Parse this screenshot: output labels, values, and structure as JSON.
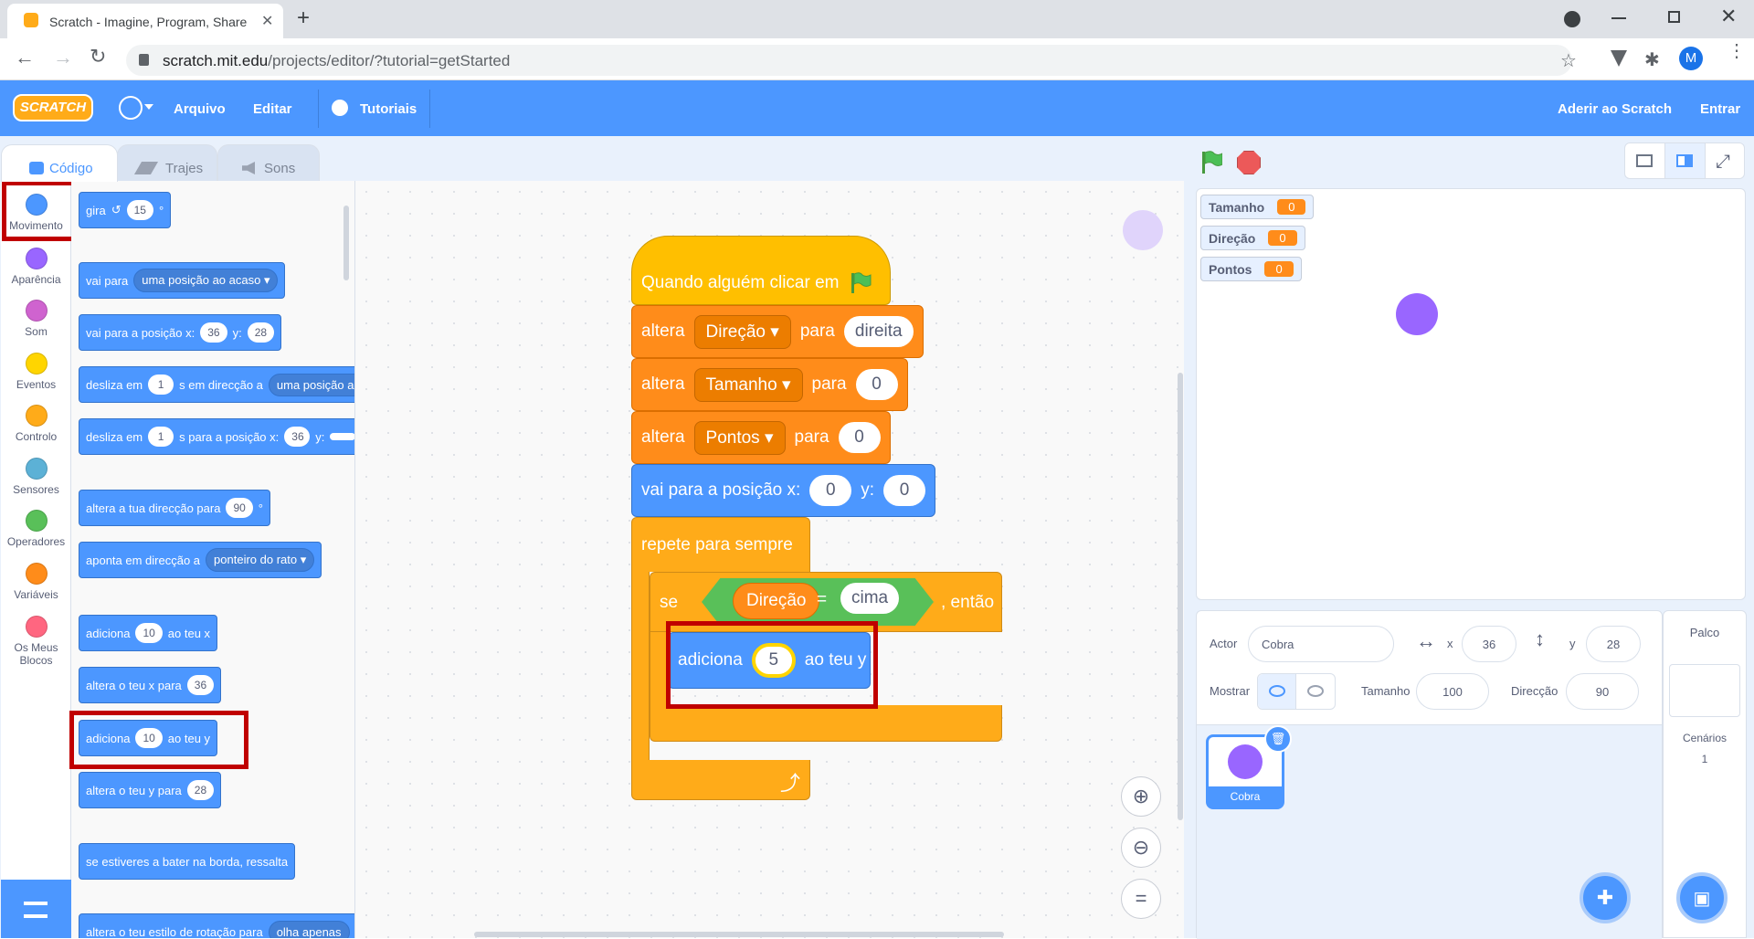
{
  "browser": {
    "tab_title": "Scratch - Imagine, Program, Share",
    "url_host": "scratch.mit.edu",
    "url_path": "/projects/editor/?tutorial=getStarted",
    "profile_initial": "M"
  },
  "menubar": {
    "logo": "SCRATCH",
    "file": "Arquivo",
    "edit": "Editar",
    "tutorials": "Tutoriais",
    "join": "Aderir ao Scratch",
    "signin": "Entrar"
  },
  "editor_tabs": {
    "code": "Código",
    "costumes": "Trajes",
    "sounds": "Sons"
  },
  "categories": [
    {
      "label": "Movimento",
      "color": "#4c97ff"
    },
    {
      "label": "Aparência",
      "color": "#9966ff"
    },
    {
      "label": "Som",
      "color": "#cf63cf"
    },
    {
      "label": "Eventos",
      "color": "#ffd500"
    },
    {
      "label": "Controlo",
      "color": "#ffab19"
    },
    {
      "label": "Sensores",
      "color": "#5cb1d6"
    },
    {
      "label": "Operadores",
      "color": "#59c059"
    },
    {
      "label": "Variáveis",
      "color": "#ff8c1a"
    },
    {
      "label": "Os Meus Blocos",
      "color": "#ff6680"
    }
  ],
  "palette": {
    "turn": {
      "label": "gira",
      "value": "15",
      "unit": "°"
    },
    "goto": {
      "label": "vai para",
      "option": "uma posição ao acaso"
    },
    "gotoxy": {
      "label": "vai para a posição x:",
      "x": "36",
      "ylabel": "y:",
      "y": "28"
    },
    "glide1": {
      "pre": "desliza em",
      "secs": "1",
      "mid": "s em direcção a",
      "option": "uma posição ao acaso"
    },
    "glide2": {
      "pre": "desliza em",
      "secs": "1",
      "mid": "s para a posição x:",
      "x": "36",
      "ylabel": "y:"
    },
    "pointdir": {
      "label": "altera a tua direcção para",
      "value": "90",
      "unit": "°"
    },
    "pointto": {
      "label": "aponta em direcção a",
      "option": "ponteiro do rato"
    },
    "changex": {
      "pre": "adiciona",
      "value": "10",
      "post": "ao teu x"
    },
    "setx": {
      "label": "altera o teu x para",
      "value": "36"
    },
    "changey": {
      "pre": "adiciona",
      "value": "10",
      "post": "ao teu y"
    },
    "sety": {
      "label": "altera o teu y para",
      "value": "28"
    },
    "bounce": {
      "label": "se estiveres a bater na borda, ressalta"
    },
    "rotstyle": {
      "label": "altera o teu estilo de rotação para",
      "option": "olha apenas"
    }
  },
  "script": {
    "hat": "Quando alguém clicar em",
    "set1": {
      "pre": "altera",
      "var": "Direção",
      "mid": "para",
      "value": "direita"
    },
    "set2": {
      "pre": "altera",
      "var": "Tamanho",
      "mid": "para",
      "value": "0"
    },
    "set3": {
      "pre": "altera",
      "var": "Pontos",
      "mid": "para",
      "value": "0"
    },
    "gotoxy": {
      "pre": "vai para a posição x:",
      "x": "0",
      "ylabel": "y:",
      "y": "0"
    },
    "forever": "repete para sempre",
    "if": {
      "pre": "se",
      "var": "Direção",
      "op": "=",
      "value": "cima",
      "post": ", então"
    },
    "changey": {
      "pre": "adiciona",
      "value": "5",
      "post": "ao teu y"
    }
  },
  "stage": {
    "monitors": [
      {
        "name": "Tamanho",
        "value": "0"
      },
      {
        "name": "Direção",
        "value": "0"
      },
      {
        "name": "Pontos",
        "value": "0"
      }
    ],
    "sprite_color": "#9966ff"
  },
  "sprite_info": {
    "actor_label": "Actor",
    "actor_name": "Cobra",
    "x_label": "x",
    "x": "36",
    "y_label": "y",
    "y": "28",
    "show_label": "Mostrar",
    "size_label": "Tamanho",
    "size": "100",
    "direction_label": "Direcção",
    "direction": "90",
    "sprite_thumb_name": "Cobra"
  },
  "stage_panel": {
    "title": "Palco",
    "backdrops_label": "Cenários",
    "backdrops_count": "1"
  }
}
